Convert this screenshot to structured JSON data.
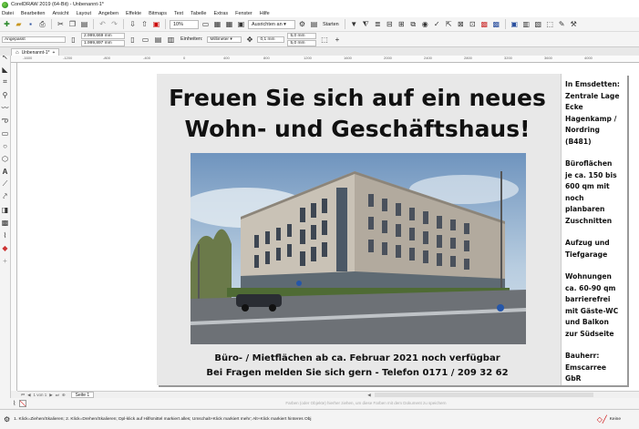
{
  "window": {
    "title": "CorelDRAW 2019 (64-Bit) - Unbenannt-1*"
  },
  "menu": [
    "Datei",
    "Bearbeiten",
    "Ansicht",
    "Layout",
    "Angeben",
    "Effekte",
    "Bitmaps",
    "Text",
    "Tabelle",
    "Extras",
    "Fenster",
    "Hilfe"
  ],
  "toolbar": {
    "zoom": "10%",
    "snap_label": "Ausrichten an",
    "start_label": "Starten"
  },
  "propbar": {
    "preset": "Angepasst",
    "width": "2.999,669 mm",
    "height": "1.999,897 mm",
    "units_label": "Einheiten:",
    "units_value": "Millimeter",
    "nudge": "0,1 mm",
    "dup_x": "5,0 mm",
    "dup_y": "5,0 mm"
  },
  "doctab": {
    "label": "Unbenannt-1*"
  },
  "ruler": {
    "ticks": [
      "-1600",
      "-1200",
      "-800",
      "-400",
      "0",
      "400",
      "800",
      "1200",
      "1600",
      "2000",
      "2400",
      "2800",
      "3200",
      "3600",
      "4000"
    ]
  },
  "flyer": {
    "headline_1": "Freuen Sie sich auf ein neues",
    "headline_2": "Wohn- und Geschäftshaus!",
    "footer_1": "Büro- / Mietflächen ab ca. Februar 2021 noch verfügbar",
    "footer_2": "Bei Fragen melden Sie sich gern - Telefon 0171 / 209 32 62",
    "sidebar": {
      "block_1": [
        "In Emsdetten:",
        "Zentrale Lage",
        "Ecke",
        "Hagenkamp /",
        "Nordring (B481)"
      ],
      "block_2": [
        "Büroflächen",
        "je ca. 150 bis",
        "600 qm mit",
        "noch planbaren",
        "Zuschnitten"
      ],
      "block_3": [
        "Aufzug und",
        "Tiefgarage"
      ],
      "block_4": [
        "Wohnungen",
        "ca. 60-90 qm",
        "barrierefrei",
        "mit Gäste-WC",
        "und Balkon",
        "zur Südseite"
      ],
      "block_5": [
        "Bauherr:",
        "Emscarree GbR"
      ]
    }
  },
  "page_nav": {
    "counter": "1 von 1",
    "page_tab": "Seite 1"
  },
  "palette_hint": "Farben (oder Objekte) hierher ziehen, um diese Farben mit dem Dokument zu speichern",
  "status": {
    "hint": "1. Klick=Ziehen/Skalieren; 2. Klick=Drehen/Skalieren; Dpl-klick auf Hilfsmittel markiert alles; Umschalt+Klick markiert mehr; Alt+Klick markiert hinteres Obj",
    "fill": "Keine"
  }
}
